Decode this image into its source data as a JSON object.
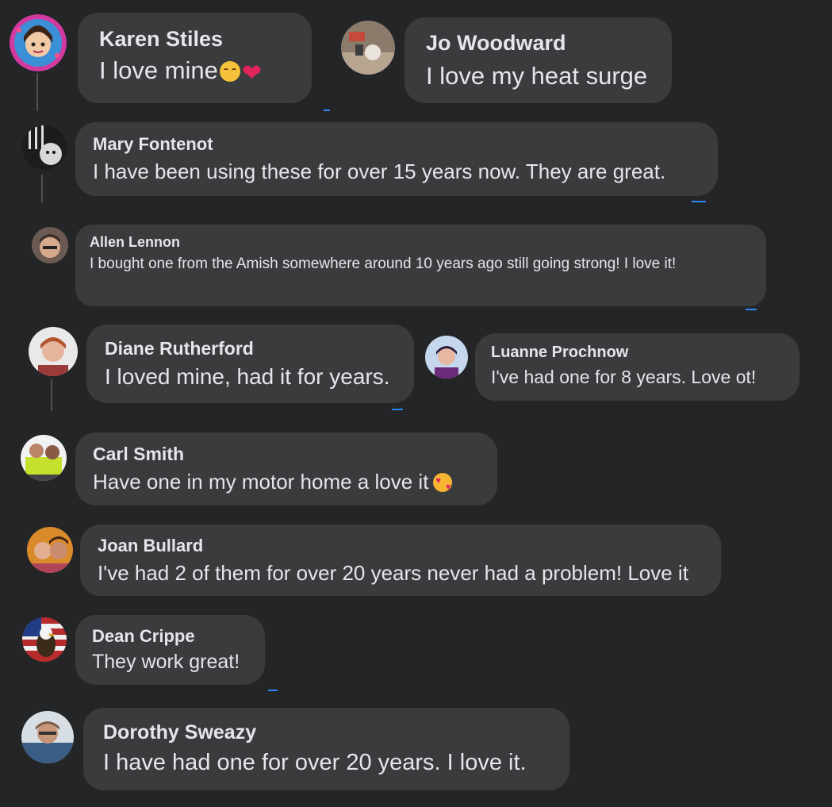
{
  "comments": [
    {
      "name": "Karen Stiles",
      "text": "I love mine",
      "emojis": [
        "smiling-face-emoji",
        "red-heart-emoji"
      ]
    },
    {
      "name": "Jo Woodward",
      "text": "I love my heat surge"
    },
    {
      "name": "Mary Fontenot",
      "text": "I have been using these for over 15 years now. They are great."
    },
    {
      "name": "Allen Lennon",
      "text": "I bought one from the Amish somewhere around 10 years ago still going strong! I love it!"
    },
    {
      "name": "Diane Rutherford",
      "text": "I loved mine, had it for years."
    },
    {
      "name": "Luanne Prochnow",
      "text": "I've had one for 8 years. Love ot!"
    },
    {
      "name": "Carl Smith",
      "text": "Have one in my motor home a love it",
      "emojis": [
        "smiling-face-with-hearts-emoji"
      ]
    },
    {
      "name": "Joan Bullard",
      "text": "I've had 2 of them for over 20 years never had a problem! Love it"
    },
    {
      "name": "Dean Crippe",
      "text": "They work great!"
    },
    {
      "name": "Dorothy Sweazy",
      "text": "I have had one for over 20 years. I love it."
    }
  ],
  "colors": {
    "background": "#232527",
    "bubble": "#3a3b3c",
    "text": "#e4e6eb",
    "accent": "#2d88ff"
  }
}
